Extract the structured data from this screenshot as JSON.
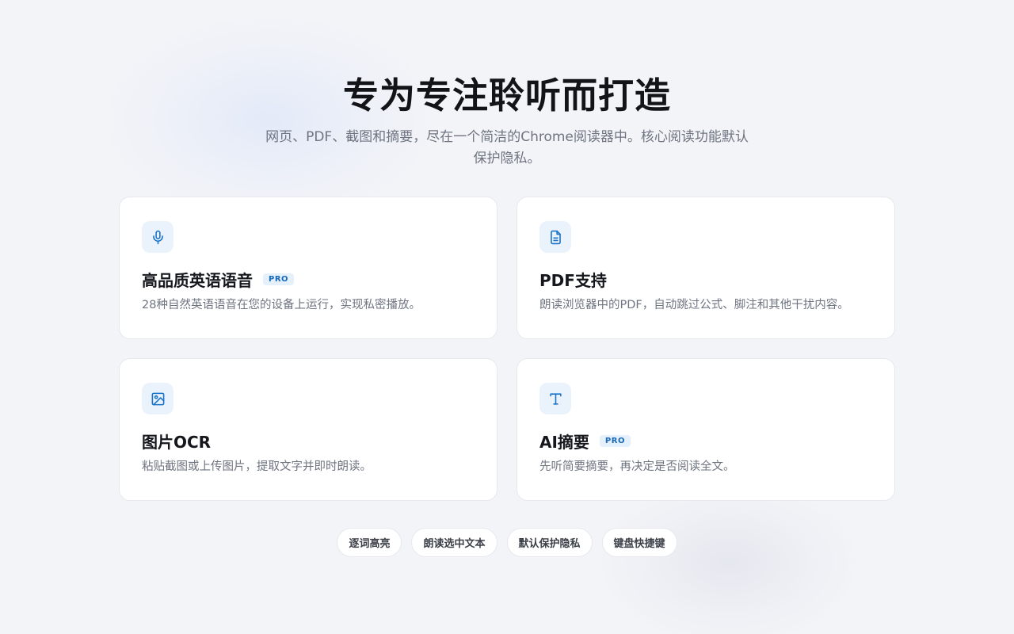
{
  "header": {
    "title": "专为专注聆听而打造",
    "subtitle": "网页、PDF、截图和摘要，尽在一个简洁的Chrome阅读器中。核心阅读功能默认保护隐私。"
  },
  "features": [
    {
      "icon": "microphone-icon",
      "title": "高品质英语语音",
      "badge": "PRO",
      "description": "28种自然英语语音在您的设备上运行，实现私密播放。"
    },
    {
      "icon": "document-icon",
      "title": "PDF支持",
      "badge": "",
      "description": "朗读浏览器中的PDF，自动跳过公式、脚注和其他干扰内容。"
    },
    {
      "icon": "image-icon",
      "title": "图片OCR",
      "badge": "",
      "description": "粘贴截图或上传图片，提取文字并即时朗读。"
    },
    {
      "icon": "text-icon",
      "title": "AI摘要",
      "badge": "PRO",
      "description": "先听简要摘要，再决定是否阅读全文。"
    }
  ],
  "tags": [
    "逐词高亮",
    "朗读选中文本",
    "默认保护隐私",
    "键盘快捷键"
  ],
  "colors": {
    "accent": "#1a73c8",
    "icon_bg": "#eaf3fc",
    "badge_text": "#1a69b8",
    "badge_bg": "#e4f0fb",
    "background": "#f3f4f8"
  }
}
